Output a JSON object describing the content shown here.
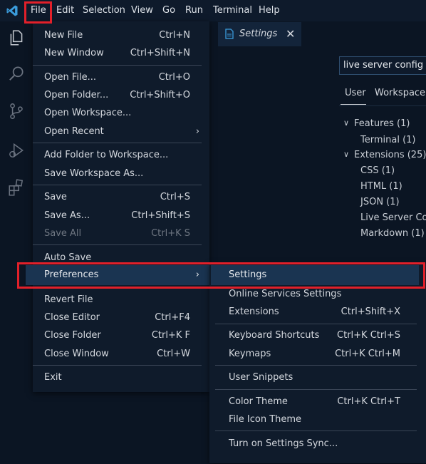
{
  "menubar": {
    "items": [
      "File",
      "Edit",
      "Selection",
      "View",
      "Go",
      "Run",
      "Terminal",
      "Help"
    ]
  },
  "icons": {
    "logo": "vscode-logo-icon",
    "activity": [
      "explorer-icon",
      "search-icon",
      "source-control-icon",
      "run-debug-icon",
      "extensions-icon"
    ]
  },
  "editor": {
    "tab_label": "Settings",
    "tab_close": "✕",
    "search_value": "live server config",
    "scope_tabs": [
      "User",
      "Workspace"
    ],
    "toc": [
      {
        "label": "Features (1)",
        "chevron": "∨"
      },
      {
        "label": "Terminal (1)"
      },
      {
        "label": "Extensions (25)",
        "chevron": "∨"
      },
      {
        "label": "CSS (1)"
      },
      {
        "label": "HTML (1)"
      },
      {
        "label": "JSON (1)"
      },
      {
        "label": "Live Server Co..."
      },
      {
        "label": "Markdown (1)"
      }
    ]
  },
  "file_menu": {
    "items": [
      {
        "label": "New File",
        "key": "Ctrl+N"
      },
      {
        "label": "New Window",
        "key": "Ctrl+Shift+N"
      },
      {
        "label": "Open File...",
        "key": "Ctrl+O"
      },
      {
        "label": "Open Folder...",
        "key": "Ctrl+Shift+O"
      },
      {
        "label": "Open Workspace...",
        "key": ""
      },
      {
        "label": "Open Recent",
        "key": ""
      },
      {
        "label": "Add Folder to Workspace...",
        "key": ""
      },
      {
        "label": "Save Workspace As...",
        "key": ""
      },
      {
        "label": "Save",
        "key": "Ctrl+S"
      },
      {
        "label": "Save As...",
        "key": "Ctrl+Shift+S"
      },
      {
        "label": "Save All",
        "key": "Ctrl+K S"
      },
      {
        "label": "Auto Save",
        "key": ""
      },
      {
        "label": "Preferences",
        "key": ""
      },
      {
        "label": "Revert File",
        "key": ""
      },
      {
        "label": "Close Editor",
        "key": "Ctrl+F4"
      },
      {
        "label": "Close Folder",
        "key": "Ctrl+K F"
      },
      {
        "label": "Close Window",
        "key": "Ctrl+W"
      },
      {
        "label": "Exit",
        "key": ""
      }
    ],
    "submenu_arrow": "›"
  },
  "pref_menu": {
    "items": [
      {
        "label": "Settings",
        "key": ""
      },
      {
        "label": "Online Services Settings",
        "key": ""
      },
      {
        "label": "Extensions",
        "key": "Ctrl+Shift+X"
      },
      {
        "label": "Keyboard Shortcuts",
        "key": "Ctrl+K Ctrl+S"
      },
      {
        "label": "Keymaps",
        "key": "Ctrl+K Ctrl+M"
      },
      {
        "label": "User Snippets",
        "key": ""
      },
      {
        "label": "Color Theme",
        "key": "Ctrl+K Ctrl+T"
      },
      {
        "label": "File Icon Theme",
        "key": ""
      },
      {
        "label": "Turn on Settings Sync...",
        "key": ""
      }
    ]
  },
  "colors": {
    "background": "#0b1523",
    "menu_bg": "#0f1b2b",
    "selection": "#1a3451",
    "highlight": "#e2202a",
    "accent": "#3b9ddd"
  }
}
